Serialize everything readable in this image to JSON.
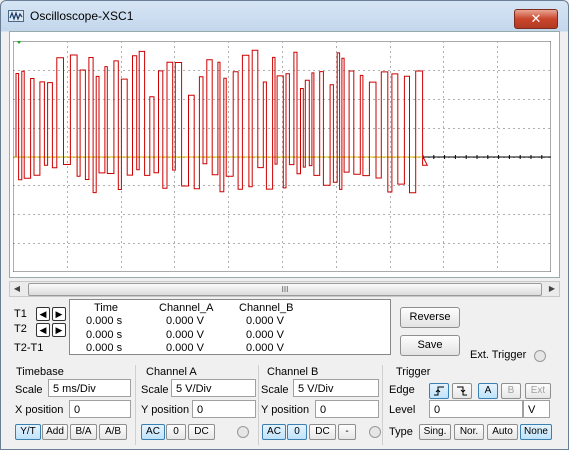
{
  "window": {
    "title": "Oscilloscope-XSC1",
    "close_label": "✕"
  },
  "colors": {
    "trace": "#cc0000",
    "grid": "#b0b0b0",
    "baseline": "#000000",
    "ground_marker": "#2aa62a"
  },
  "icons": {
    "app": "oscilloscope-icon",
    "left": "arrow-left-icon",
    "right": "arrow-right-icon"
  },
  "scrollbar": {
    "grip": "III"
  },
  "cursors": {
    "t1": "T1",
    "t2": "T2",
    "t2t1": "T2-T1",
    "headers": [
      "Time",
      "Channel_A",
      "Channel_B"
    ],
    "rows": [
      [
        "0.000 s",
        "0.000 V",
        "0.000 V"
      ],
      [
        "0.000 s",
        "0.000 V",
        "0.000 V"
      ],
      [
        "0.000 s",
        "0.000 V",
        "0.000 V"
      ]
    ]
  },
  "buttons": {
    "reverse": "Reverse",
    "save": "Save",
    "ext_trigger": "Ext. Trigger"
  },
  "timebase": {
    "title": "Timebase",
    "scale_label": "Scale",
    "scale_value": "5 ms/Div",
    "xpos_label": "X position",
    "xpos_value": "0",
    "modes": [
      "Y/T",
      "Add",
      "B/A",
      "A/B"
    ]
  },
  "channel_a": {
    "title": "Channel A",
    "scale_label": "Scale",
    "scale_value": "5  V/Div",
    "ypos_label": "Y position",
    "ypos_value": "0",
    "coupling": [
      "AC",
      "0",
      "DC"
    ]
  },
  "channel_b": {
    "title": "Channel B",
    "scale_label": "Scale",
    "scale_value": "5  V/Div",
    "ypos_label": "Y position",
    "ypos_value": "0",
    "coupling": [
      "AC",
      "0",
      "DC",
      "-"
    ]
  },
  "trigger": {
    "title": "Trigger",
    "edge_label": "Edge",
    "edge_sources": [
      "A",
      "B",
      "Ext"
    ],
    "level_label": "Level",
    "level_value": "0",
    "level_unit": "V",
    "type_label": "Type",
    "types": [
      "Sing.",
      "Nor.",
      "Auto",
      "None"
    ]
  }
}
